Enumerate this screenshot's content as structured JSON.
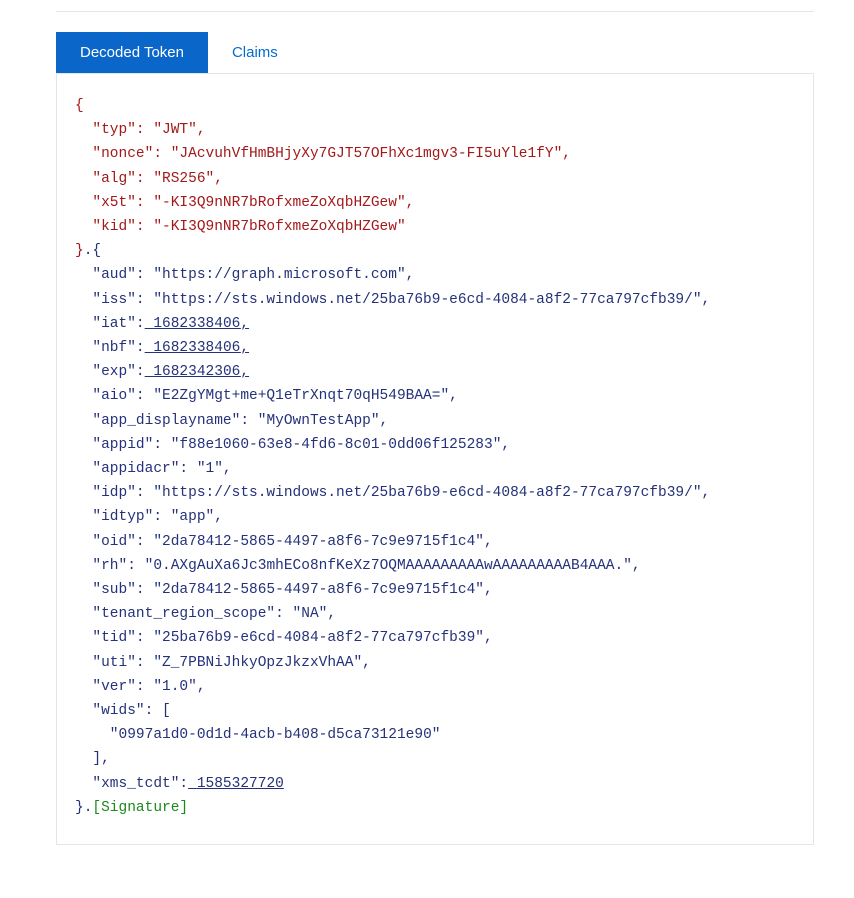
{
  "tabs": {
    "decoded": "Decoded Token",
    "claims": "Claims"
  },
  "token": {
    "header": {
      "typ": "JWT",
      "nonce": "JAcvuhVfHmBHjyXy7GJT57OFhXc1mgv3-FI5uYle1fY",
      "alg": "RS256",
      "x5t": "-KI3Q9nNR7bRofxmeZoXqbHZGew",
      "kid": "-KI3Q9nNR7bRofxmeZoXqbHZGew"
    },
    "payload": {
      "aud": "https://graph.microsoft.com",
      "iss": "https://sts.windows.net/25ba76b9-e6cd-4084-a8f2-77ca797cfb39/",
      "iat": "1682338406",
      "nbf": "1682338406",
      "exp": "1682342306",
      "aio": "E2ZgYMgt+me+Q1eTrXnqt70qH549BAA=",
      "app_displayname": "MyOwnTestApp",
      "appid": "f88e1060-63e8-4fd6-8c01-0dd06f125283",
      "appidacr": "1",
      "idp": "https://sts.windows.net/25ba76b9-e6cd-4084-a8f2-77ca797cfb39/",
      "idtyp": "app",
      "oid": "2da78412-5865-4497-a8f6-7c9e9715f1c4",
      "rh": "0.AXgAuXa6Jc3mhECo8nfKeXz7OQMAAAAAAAAAwAAAAAAAAAB4AAA.",
      "sub": "2da78412-5865-4497-a8f6-7c9e9715f1c4",
      "tenant_region_scope": "NA",
      "tid": "25ba76b9-e6cd-4084-a8f2-77ca797cfb39",
      "uti": "Z_7PBNiJhkyOpzJkzxVhAA",
      "ver": "1.0",
      "wids0": "0997a1d0-0d1d-4acb-b408-d5ca73121e90",
      "xms_tcdt": "1585327720"
    },
    "signature_label": "[Signature]"
  }
}
